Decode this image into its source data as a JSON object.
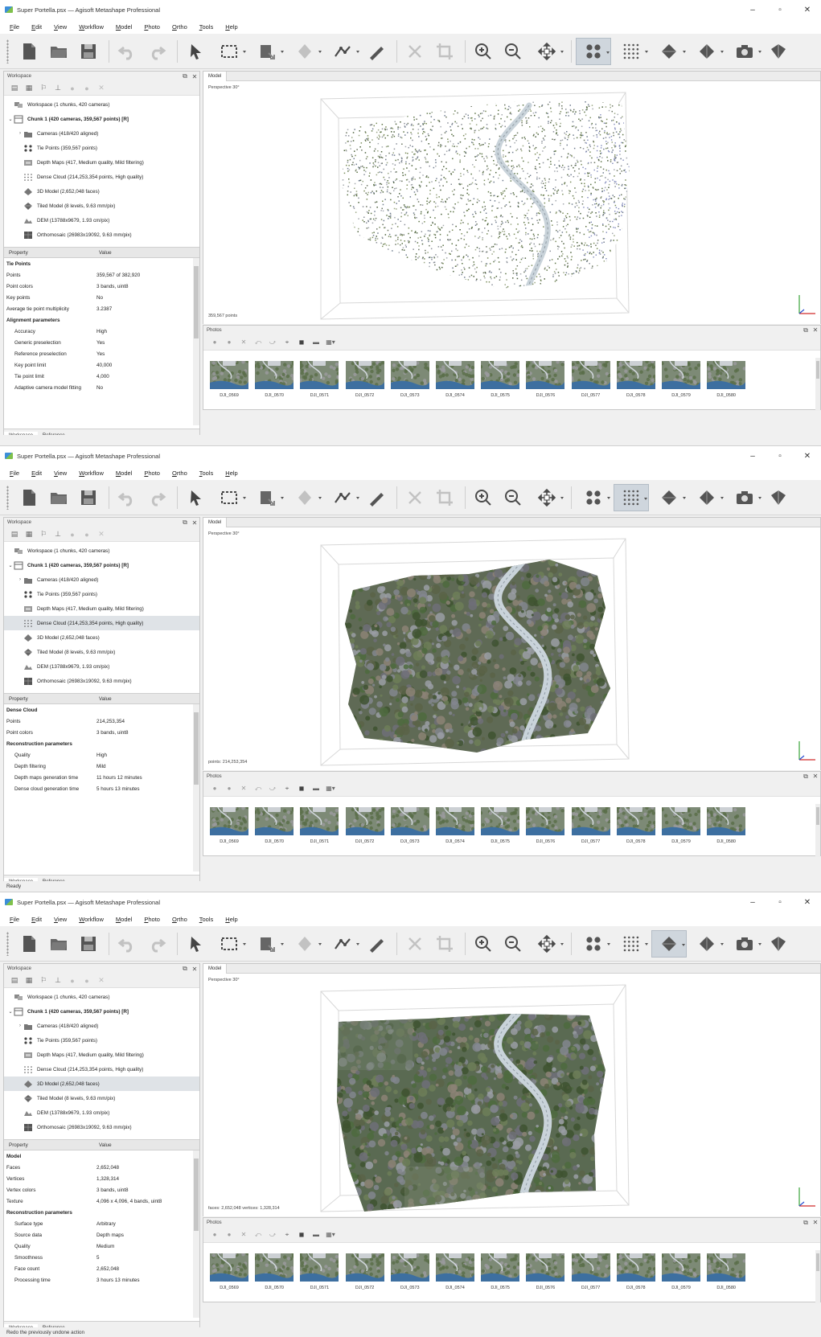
{
  "title": "Super Portella.psx — Agisoft Metashape Professional",
  "menu": [
    "File",
    "Edit",
    "View",
    "Workflow",
    "Model",
    "Photo",
    "Ortho",
    "Tools",
    "Help"
  ],
  "workspace_panel": {
    "title": "Workspace",
    "root": "Workspace (1 chunks, 420 cameras)",
    "chunk": "Chunk 1 (420 cameras, 359,567 points) [R]",
    "items": [
      {
        "label": "Cameras (418/420 aligned)",
        "icon": "folder-icon"
      },
      {
        "label": "Tie Points (359,567 points)",
        "icon": "tie-points-icon"
      },
      {
        "label": "Depth Maps (417, Medium quality, Mild filtering)",
        "icon": "depth-maps-icon"
      },
      {
        "label": "Dense Cloud (214,253,354 points, High quality)",
        "icon": "dense-cloud-icon"
      },
      {
        "label": "3D Model (2,652,048 faces)",
        "icon": "mesh-icon"
      },
      {
        "label": "Tiled Model (8 levels, 9.63 mm/pix)",
        "icon": "tiled-model-icon"
      },
      {
        "label": "DEM (13788x9679, 1.93 cm/pix)",
        "icon": "dem-icon"
      },
      {
        "label": "Orthomosaic (26983x19092, 9.63 mm/pix)",
        "icon": "orthomosaic-icon"
      }
    ]
  },
  "property_header": {
    "property": "Property",
    "value": "Value"
  },
  "tabs": {
    "workspace": "Workspace",
    "reference": "Reference"
  },
  "model_panel": {
    "tab": "Model",
    "perspective": "Perspective 30°"
  },
  "photos_panel": {
    "title": "Photos",
    "photos": [
      "DJI_0569",
      "DJI_0570",
      "DJI_0571",
      "DJI_0572",
      "DJI_0573",
      "DJI_0574",
      "DJI_0575",
      "DJI_0576",
      "DJI_0577",
      "DJI_0578",
      "DJI_0579",
      "DJI_0580"
    ]
  },
  "toolbar_icons": [
    "new-icon",
    "open-icon",
    "save-icon",
    "undo-icon",
    "redo-icon",
    "navigation-icon",
    "rectangle-selection-icon",
    "resize-region-icon",
    "rotate-object-icon",
    "ruler-icon",
    "measure-icon",
    "delete-icon",
    "crop-icon",
    "zoom-in-icon",
    "zoom-out-icon",
    "move-region-icon",
    "tie-points-view-icon",
    "dense-cloud-view-icon",
    "model-view-icon",
    "textured-model-icon",
    "camera-icon",
    "show-cameras-icon"
  ],
  "windows": [
    {
      "active_view": "tie-points",
      "selected_tree_index": -1,
      "count_label": "359,567 points",
      "properties": [
        {
          "type": "section",
          "name": "Tie Points"
        },
        {
          "name": "Points",
          "value": "359,567 of 382,920"
        },
        {
          "name": "Point colors",
          "value": "3 bands, uint8"
        },
        {
          "name": "Key points",
          "value": "No"
        },
        {
          "name": "Average tie point multiplicity",
          "value": "3.2387"
        },
        {
          "type": "section",
          "name": "Alignment parameters"
        },
        {
          "name": "Accuracy",
          "value": "High",
          "indent": true
        },
        {
          "name": "Generic preselection",
          "value": "Yes",
          "indent": true
        },
        {
          "name": "Reference preselection",
          "value": "Yes",
          "indent": true
        },
        {
          "name": "Key point limit",
          "value": "40,000",
          "indent": true
        },
        {
          "name": "Tie point limit",
          "value": "4,000",
          "indent": true
        },
        {
          "name": "Adaptive camera model fitting",
          "value": "No",
          "indent": true
        }
      ],
      "status": ""
    },
    {
      "active_view": "dense-cloud",
      "selected_tree_index": 3,
      "count_label": "points: 214,253,354",
      "properties": [
        {
          "type": "section",
          "name": "Dense Cloud"
        },
        {
          "name": "Points",
          "value": "214,253,354"
        },
        {
          "name": "Point colors",
          "value": "3 bands, uint8"
        },
        {
          "type": "section",
          "name": "Reconstruction parameters"
        },
        {
          "name": "Quality",
          "value": "High",
          "indent": true
        },
        {
          "name": "Depth filtering",
          "value": "Mild",
          "indent": true
        },
        {
          "name": "Depth maps generation time",
          "value": "11 hours 12 minutes",
          "indent": true
        },
        {
          "name": "Dense cloud generation time",
          "value": "5 hours 13 minutes",
          "indent": true
        }
      ],
      "status": "Ready"
    },
    {
      "active_view": "textured-model",
      "selected_tree_index": 4,
      "count_label": "faces: 2,652,048 vertices: 1,328,314",
      "properties": [
        {
          "type": "section",
          "name": "Model"
        },
        {
          "name": "Faces",
          "value": "2,652,048"
        },
        {
          "name": "Vertices",
          "value": "1,328,314"
        },
        {
          "name": "Vertex colors",
          "value": "3 bands, uint8"
        },
        {
          "name": "Texture",
          "value": "4,096 x 4,096, 4 bands, uint8"
        },
        {
          "type": "section",
          "name": "Reconstruction parameters"
        },
        {
          "name": "Surface type",
          "value": "Arbitrary",
          "indent": true
        },
        {
          "name": "Source data",
          "value": "Depth maps",
          "indent": true
        },
        {
          "name": "Quality",
          "value": "Medium",
          "indent": true
        },
        {
          "name": "Smoothness",
          "value": "5",
          "indent": true
        },
        {
          "name": "Face count",
          "value": "2,652,048",
          "indent": true
        },
        {
          "name": "Processing time",
          "value": "3 hours 13 minutes",
          "indent": true
        }
      ],
      "status": "Redo the previously undone action"
    }
  ],
  "colors": {
    "selection": "#dfe3e7",
    "panel_bg": "#f0f0f0",
    "road": "#c9d3da",
    "vegetation": "#4f6b3f",
    "ground": "#7b7f86"
  }
}
